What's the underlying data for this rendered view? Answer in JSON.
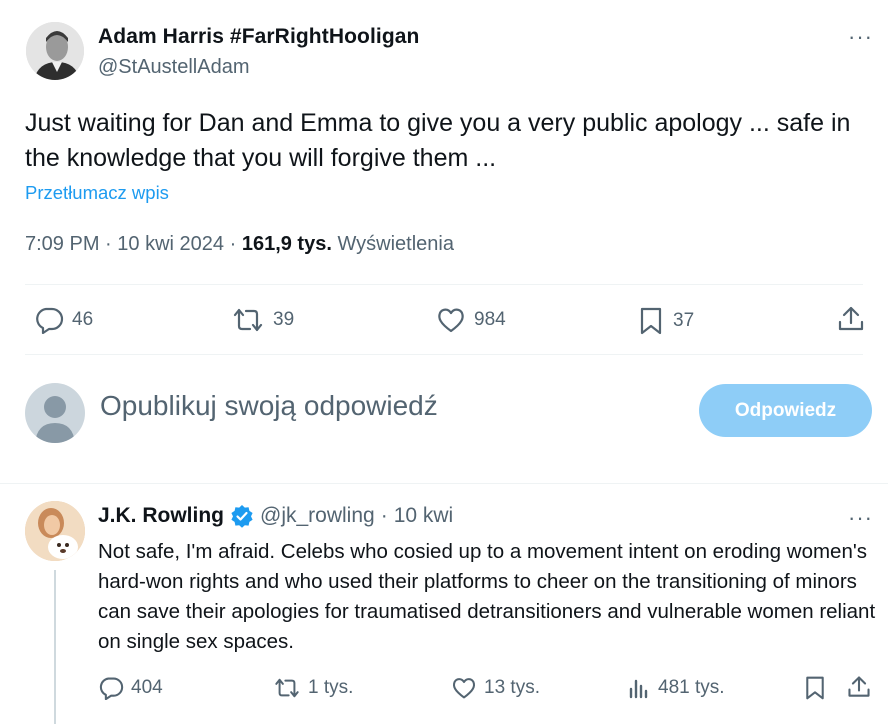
{
  "main_tweet": {
    "author_name": "Adam Harris #FarRightHooligan",
    "author_handle": "@StAustellAdam",
    "more_label": "···",
    "text": "Just waiting for Dan and Emma to give you a very public apology ... safe in the knowledge that you will forgive them ...",
    "translate_label": "Przetłumacz wpis",
    "time": "7:09 PM",
    "sep1": "·",
    "date": "10 kwi 2024",
    "sep2": "·",
    "views_count": "161,9 tys.",
    "views_label": "Wyświetlenia",
    "actions": {
      "replies": "46",
      "reposts": "39",
      "likes": "984",
      "bookmarks": "37"
    }
  },
  "composer": {
    "placeholder": "Opublikuj swoją odpowiedź",
    "button_label": "Odpowiedz"
  },
  "reply_tweet": {
    "author_name": "J.K. Rowling",
    "author_handle": "@jk_rowling",
    "sep": "·",
    "date": "10 kwi",
    "more_label": "···",
    "text": "Not safe, I'm afraid. Celebs who cosied up to a movement intent on eroding women's hard-won rights and who used their platforms to cheer on the transitioning of minors can save their apologies for traumatised detransitioners and vulnerable women reliant on single sex spaces.",
    "actions": {
      "replies": "404",
      "reposts": "1 tys.",
      "likes": "13 tys.",
      "views": "481 tys."
    }
  },
  "colors": {
    "accent": "#1d9bf0",
    "muted": "#536471",
    "button_disabled": "#8ecdf7",
    "divider": "#eff3f4"
  },
  "icons": [
    "reply-icon",
    "repost-icon",
    "like-icon",
    "bookmark-icon",
    "share-icon",
    "views-icon",
    "verified-badge-icon",
    "more-icon"
  ]
}
